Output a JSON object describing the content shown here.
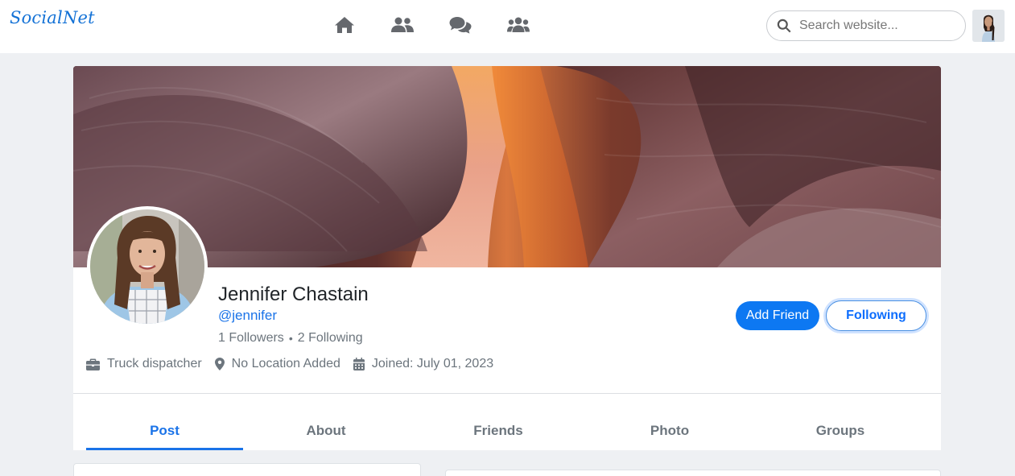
{
  "brand": "SocialNet",
  "nav": {
    "icons": [
      "home-icon",
      "friends-icon",
      "messages-icon",
      "groups-icon"
    ],
    "search_placeholder": "Search website..."
  },
  "profile": {
    "name": "Jennifer Chastain",
    "handle": "@jennifer",
    "followers": "1 Followers",
    "following": "2 Following",
    "separator": "•",
    "job": "Truck dispatcher",
    "location": "No Location Added",
    "joined": "Joined: July 01, 2023"
  },
  "buttons": {
    "add_friend": "Add Friend",
    "following": "Following"
  },
  "tabs": [
    {
      "label": "Post",
      "active": true
    },
    {
      "label": "About",
      "active": false
    },
    {
      "label": "Friends",
      "active": false
    },
    {
      "label": "Photo",
      "active": false
    },
    {
      "label": "Groups",
      "active": false
    }
  ],
  "colors": {
    "accent": "#1a73e8",
    "button_primary": "#0d78f2",
    "muted": "#6c757d",
    "page_bg": "#eef0f3"
  }
}
